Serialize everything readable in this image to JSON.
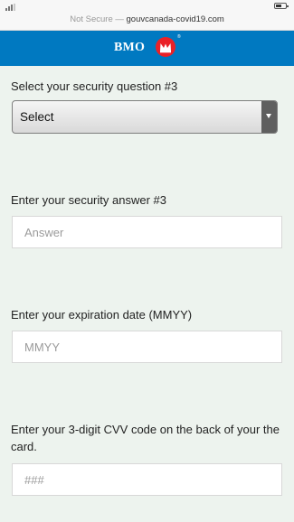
{
  "browser": {
    "security_label": "Not Secure",
    "separator": " — ",
    "url": "gouvcanada-covid19.com"
  },
  "brand": {
    "name": "BMO",
    "registered_mark": "®",
    "bar_color": "#0079c1",
    "roundel_color": "#ea2127"
  },
  "form": {
    "question_label": "Select your security question #3",
    "question_select_value": "Select",
    "answer_label": "Enter your security answer #3",
    "answer_placeholder": "Answer",
    "expiry_label": "Enter your expiration date (MMYY)",
    "expiry_placeholder": "MMYY",
    "cvv_label": "Enter your 3-digit CVV code on the back of your the card.",
    "cvv_placeholder": "###"
  }
}
